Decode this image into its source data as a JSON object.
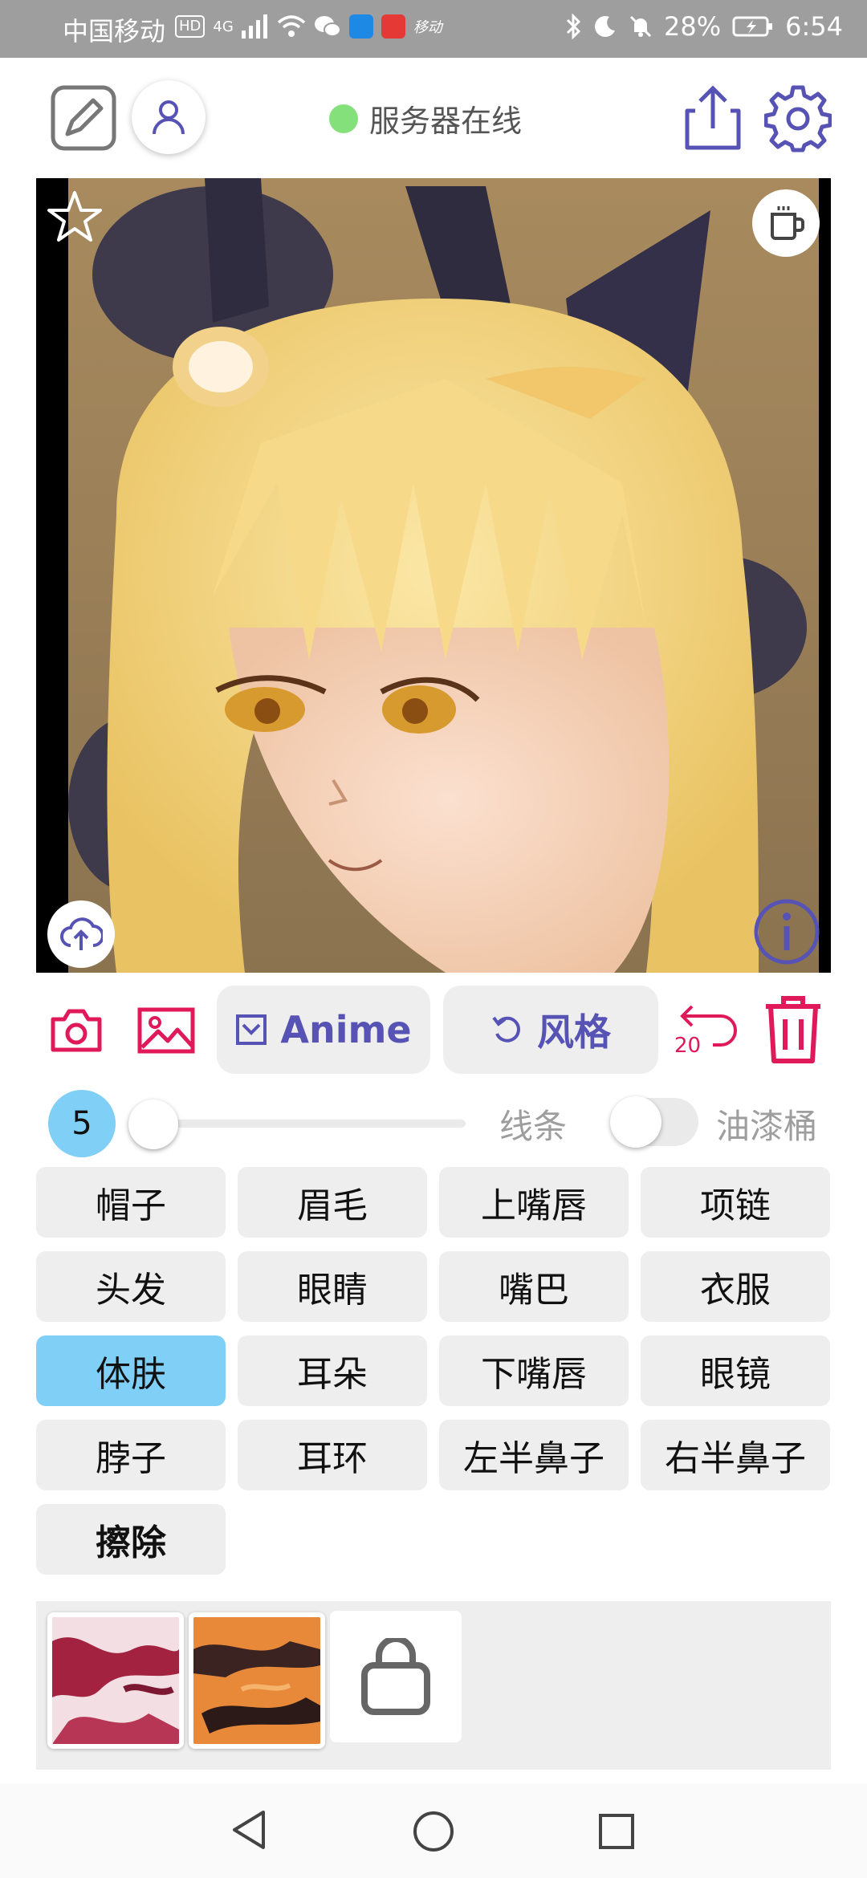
{
  "status_bar": {
    "carrier": "中国移动",
    "hd_badge": "HD",
    "network": "4G",
    "app_badge": "移动",
    "battery": "28%",
    "time": "6:54"
  },
  "top_bar": {
    "server_status": "服务器在线",
    "status_color": "#84e07a",
    "accent_color": "#5653b5"
  },
  "toolbar": {
    "anime_label": "Anime",
    "style_label": "风格",
    "undo_count": "20",
    "danger_color": "#e0195a"
  },
  "brush": {
    "size": "5",
    "size_fraction": 0.0,
    "lines_label": "线条",
    "bucket_label": "油漆桶",
    "bucket_enabled": false
  },
  "parts": [
    {
      "label": "帽子",
      "selected": false
    },
    {
      "label": "眉毛",
      "selected": false
    },
    {
      "label": "上嘴唇",
      "selected": false
    },
    {
      "label": "项链",
      "selected": false
    },
    {
      "label": "头发",
      "selected": false
    },
    {
      "label": "眼睛",
      "selected": false
    },
    {
      "label": "嘴巴",
      "selected": false
    },
    {
      "label": "衣服",
      "selected": false
    },
    {
      "label": "体肤",
      "selected": true
    },
    {
      "label": "耳朵",
      "selected": false
    },
    {
      "label": "下嘴唇",
      "selected": false
    },
    {
      "label": "眼镜",
      "selected": false
    },
    {
      "label": "脖子",
      "selected": false
    },
    {
      "label": "耳环",
      "selected": false
    },
    {
      "label": "左半鼻子",
      "selected": false
    },
    {
      "label": "右半鼻子",
      "selected": false
    },
    {
      "label": "擦除",
      "selected": false
    }
  ],
  "selected_color": "#7fcff7",
  "textures": [
    "texture-red-white",
    "texture-orange-black",
    "shop-bag-icon"
  ]
}
